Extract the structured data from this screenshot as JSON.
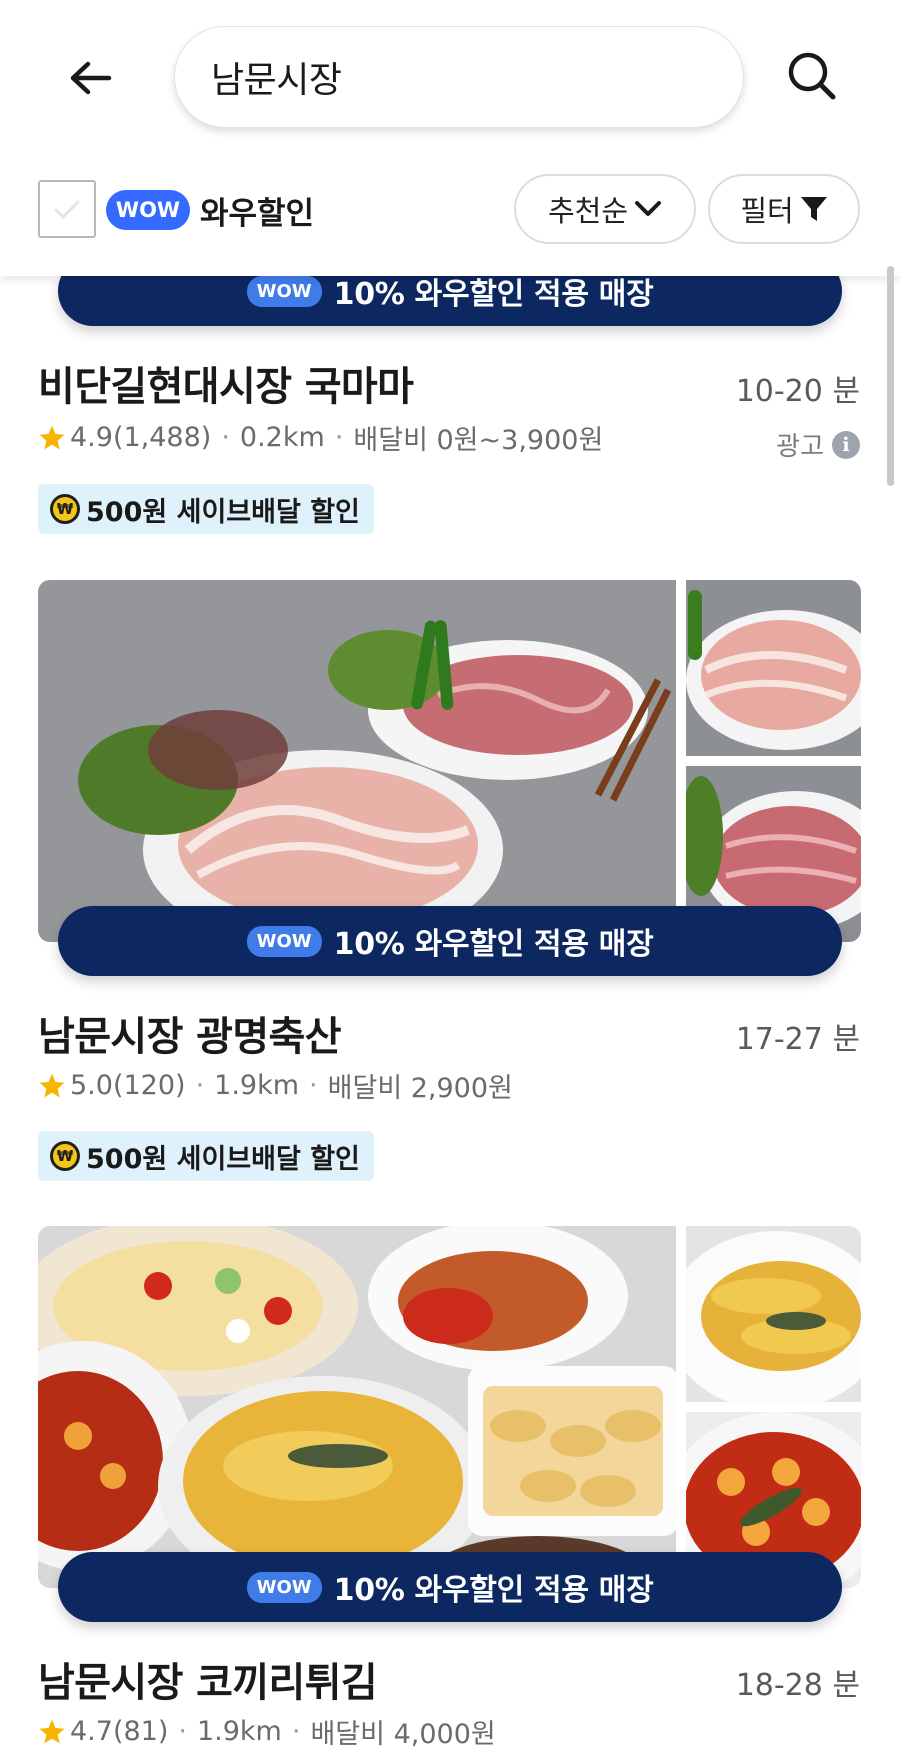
{
  "header": {
    "back_icon": "arrow-left-icon",
    "search_value": "남문시장",
    "search_icon": "search-icon"
  },
  "filters": {
    "wow_badge": "WOW",
    "wow_label": "와우할인",
    "wow_checked": false,
    "sort_label": "추천순",
    "filter_label": "필터"
  },
  "colors": {
    "wow_blue": "#346aff",
    "banner_navy": "#0d2760",
    "promo_bg": "#dff1fb",
    "star": "#f7b500"
  },
  "stores": [
    {
      "banner_badge": "WOW",
      "banner_text": "10% 와우할인 적용 매장",
      "name": "비단길현대시장 국마마",
      "eta": "10-20 분",
      "rating": "4.9",
      "reviews": "(1,488)",
      "distance": "0.2km",
      "delivery_fee": "배달비 0원~3,900원",
      "ad_label": "광고",
      "promo": "500원 세이브배달 할인"
    },
    {
      "banner_badge": "WOW",
      "banner_text": "10% 와우할인 적용 매장",
      "name": "남문시장 광명축산",
      "eta": "17-27 분",
      "rating": "5.0",
      "reviews": "(120)",
      "distance": "1.9km",
      "delivery_fee": "배달비 2,900원",
      "promo": "500원 세이브배달 할인"
    },
    {
      "banner_badge": "WOW",
      "banner_text": "10% 와우할인 적용 매장",
      "name": "남문시장 코끼리튀김",
      "eta": "18-28 분",
      "rating": "4.7",
      "reviews": "(81)",
      "distance": "1.9km",
      "delivery_fee": "배달비 4,000원"
    }
  ]
}
